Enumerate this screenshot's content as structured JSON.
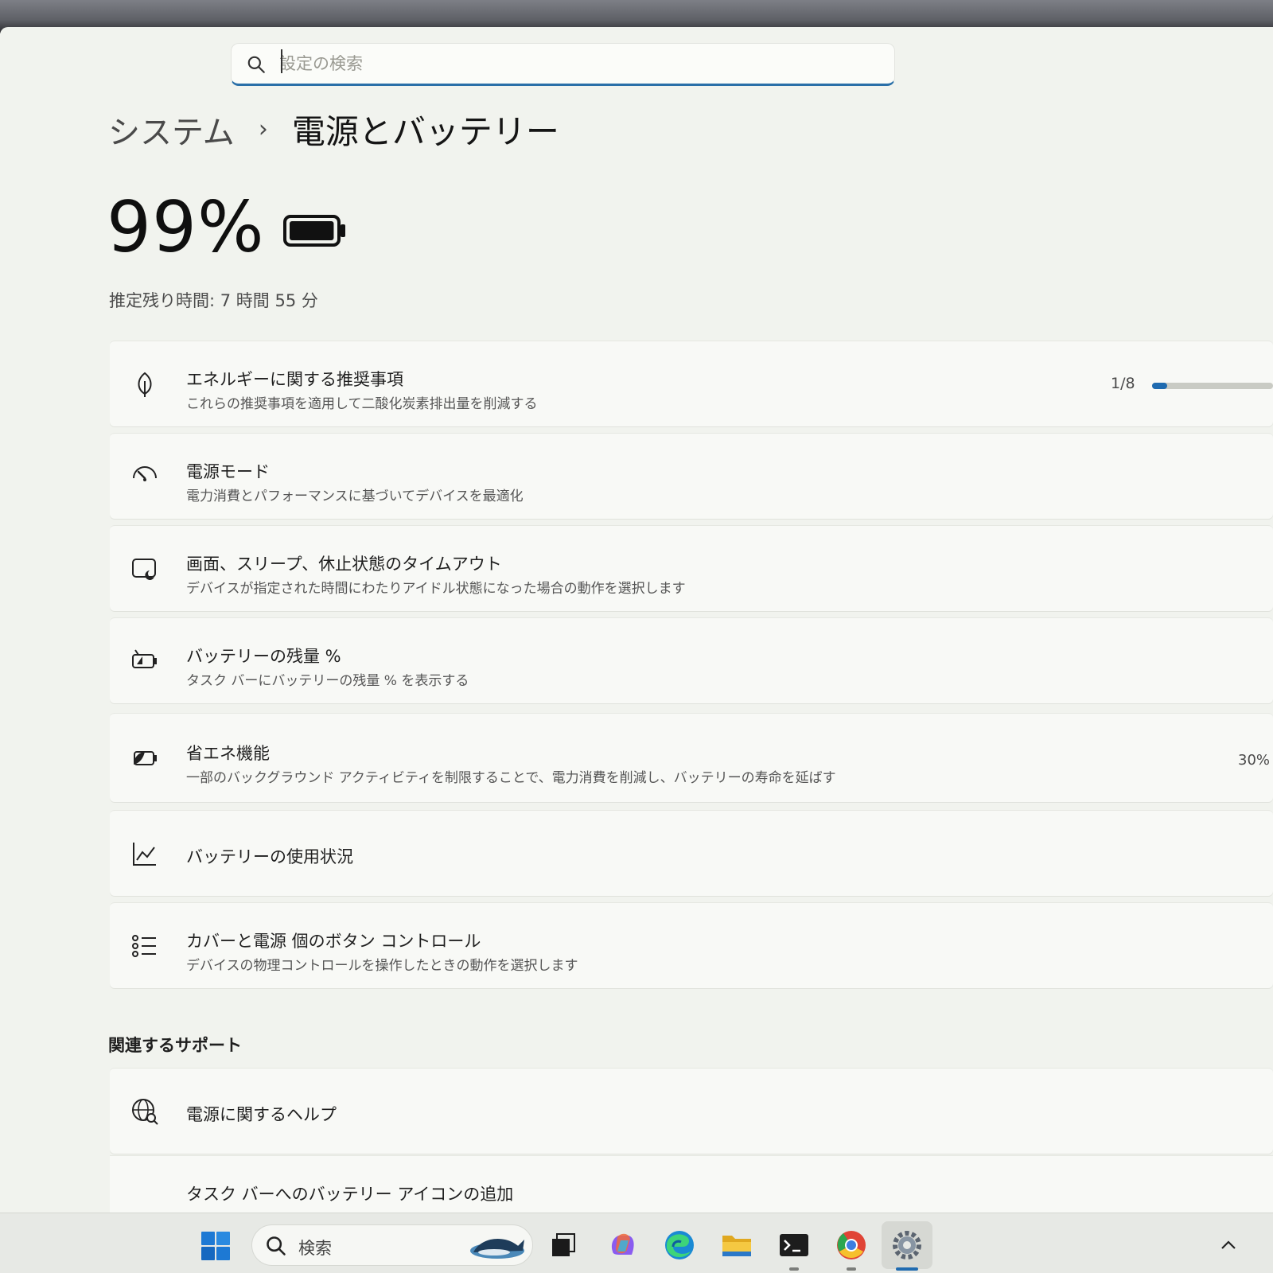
{
  "search": {
    "placeholder": "設定の検索"
  },
  "breadcrumb": {
    "parent": "システム",
    "separator": "›",
    "current": "電源とバッテリー"
  },
  "battery": {
    "percent_label": "99%",
    "level": 0.99,
    "remaining": "推定残り時間: 7 時間 55 分"
  },
  "cards": [
    {
      "icon": "leaf-icon",
      "title": "エネルギーに関する推奨事項",
      "subtitle": "これらの推奨事項を適用して二酸化炭素排出量を削減する",
      "right": "1/8",
      "progress": 0.125
    },
    {
      "icon": "power-mode-gauge-icon",
      "title": "電源モード",
      "subtitle": "電力消費とパフォーマンスに基づいてデバイスを最適化"
    },
    {
      "icon": "screen-sleep-icon",
      "title": "画面、スリープ、休止状態のタイムアウト",
      "subtitle": "デバイスが指定された時間にわたりアイドル状態になった場合の動作を選択します"
    },
    {
      "icon": "battery-percent-icon",
      "title": "バッテリーの残量 %",
      "subtitle": "タスク バーにバッテリーの残量 % を表示する"
    },
    {
      "icon": "energy-saver-icon",
      "title": "省エネ機能",
      "subtitle": "一部のバックグラウンド アクティビティを制限することで、電力消費を削減し、バッテリーの寿命を延ばす",
      "right": "30%"
    },
    {
      "icon": "chart-line-icon",
      "title": "バッテリーの使用状況"
    },
    {
      "icon": "list-icon",
      "title": "カバーと電源 個のボタン コントロール",
      "subtitle": "デバイスの物理コントロールを操作したときの動作を選択します"
    }
  ],
  "related": {
    "title": "関連するサポート",
    "help_title": "電源に関するヘルプ",
    "link": "タスク バーへのバッテリー アイコンの追加"
  },
  "taskbar": {
    "search_label": "検索",
    "apps": [
      "task-view-icon",
      "copilot-icon",
      "edge-icon",
      "file-explorer-icon",
      "terminal-icon",
      "chrome-icon",
      "settings-icon"
    ]
  },
  "colors": {
    "accent": "#1f6bb0",
    "link": "#1e4f85"
  }
}
